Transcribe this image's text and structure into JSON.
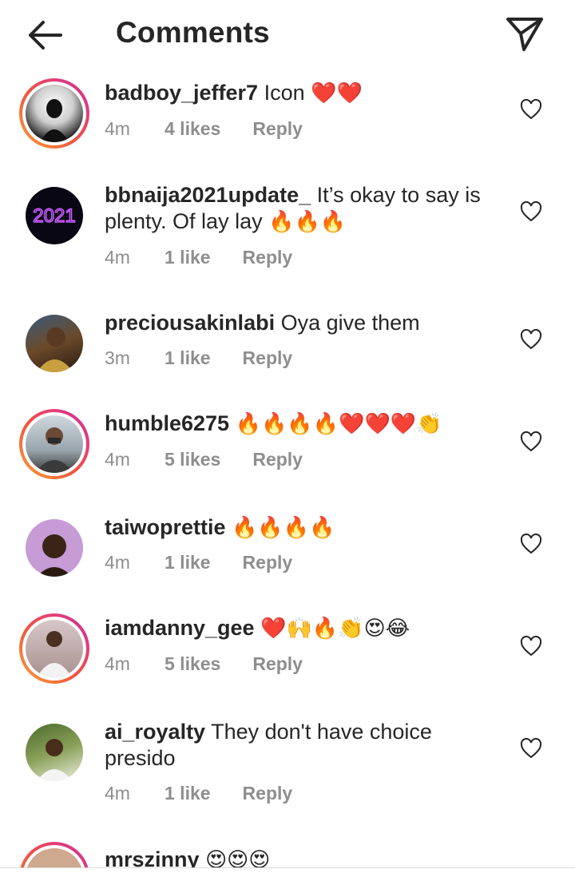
{
  "header": {
    "title": "Comments",
    "back_icon": "arrow-left-icon",
    "share_icon": "paper-plane-icon"
  },
  "colors": {
    "text": "#262626",
    "muted": "#8e8e8e",
    "heart": "#ed1c24",
    "ring": "#e33d7a"
  },
  "comments": [
    {
      "username": "badboy_jeffer7",
      "text": "Icon",
      "emoji": "❤️❤️",
      "time": "4m",
      "likes": "4 likes",
      "reply": "Reply",
      "story_ring": true
    },
    {
      "username": "bbnaija2021update_",
      "text": "It’s okay to say is plenty. Of lay lay",
      "emoji": "🔥🔥🔥",
      "time": "4m",
      "likes": "1 like",
      "reply": "Reply",
      "story_ring": false,
      "avatar_text": "2021"
    },
    {
      "username": "preciousakinlabi",
      "text": "Oya give them",
      "emoji": "",
      "time": "3m",
      "likes": "1 like",
      "reply": "Reply",
      "story_ring": false
    },
    {
      "username": "humble6275",
      "text": "",
      "emoji": "🔥🔥🔥🔥❤️❤️❤️👏",
      "time": "4m",
      "likes": "5 likes",
      "reply": "Reply",
      "story_ring": true
    },
    {
      "username": "taiwoprettie",
      "text": "",
      "emoji": "🔥🔥🔥🔥",
      "time": "4m",
      "likes": "1 like",
      "reply": "Reply",
      "story_ring": false
    },
    {
      "username": "iamdanny_gee",
      "text": "",
      "emoji": "❤️🙌🔥👏😍😂",
      "time": "4m",
      "likes": "5 likes",
      "reply": "Reply",
      "story_ring": true
    },
    {
      "username": "ai_royalty",
      "text": "They don't have choice presido",
      "emoji": "",
      "time": "4m",
      "likes": "1 like",
      "reply": "Reply",
      "story_ring": false
    },
    {
      "username": "mrszinny",
      "text": "",
      "emoji": "😍😍😍",
      "time": "",
      "likes": "",
      "reply": "",
      "story_ring": true
    }
  ]
}
